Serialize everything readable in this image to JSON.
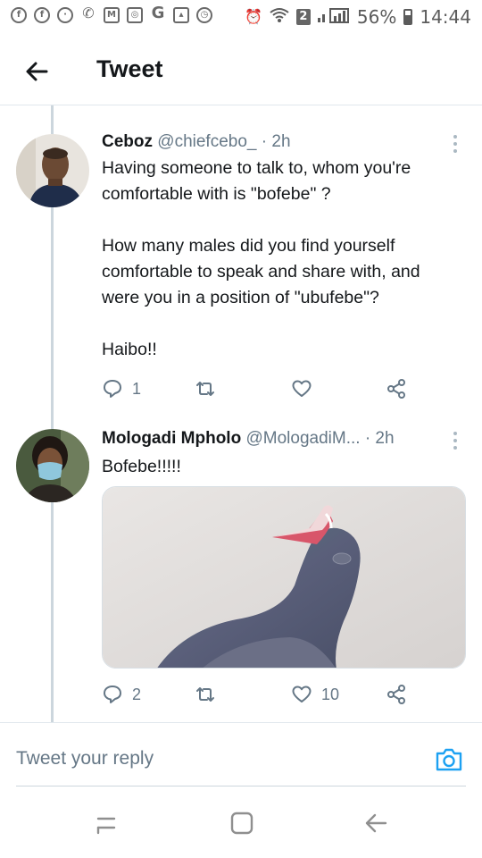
{
  "status_bar": {
    "notification_icons": [
      "facebook-icon",
      "facebook-icon",
      "messenger-icon",
      "missed-call-icon",
      "gmail-icon",
      "instagram-icon",
      "google-icon",
      "gallery-icon",
      "clock-icon"
    ],
    "sim_badge": "2",
    "battery": "56%",
    "time": "14:44"
  },
  "header": {
    "title": "Tweet"
  },
  "tweets": [
    {
      "name": "Ceboz",
      "handle": "@chiefcebo_",
      "separator": "·",
      "time": "2h",
      "body": "Having someone to talk to, whom you're comfortable with is \"bofebe\" ?\n\nHow many males did you find yourself comfortable to speak and share with, and were you in a position of \"ubufebe\"?\n\nHaibo!!",
      "replies": "1",
      "retweets": "",
      "likes": ""
    },
    {
      "name": "Mologadi Mpholo",
      "handle": "@MologadiM...",
      "separator": "·",
      "time": "2h",
      "body": "Bofebe!!!!!",
      "replies": "2",
      "retweets": "",
      "likes": "10"
    }
  ],
  "reply_bar": {
    "placeholder": "Tweet your reply"
  },
  "colors": {
    "text": "#14171a",
    "muted": "#657786",
    "accent": "#1da1f2",
    "divider": "#e1e8ed"
  }
}
